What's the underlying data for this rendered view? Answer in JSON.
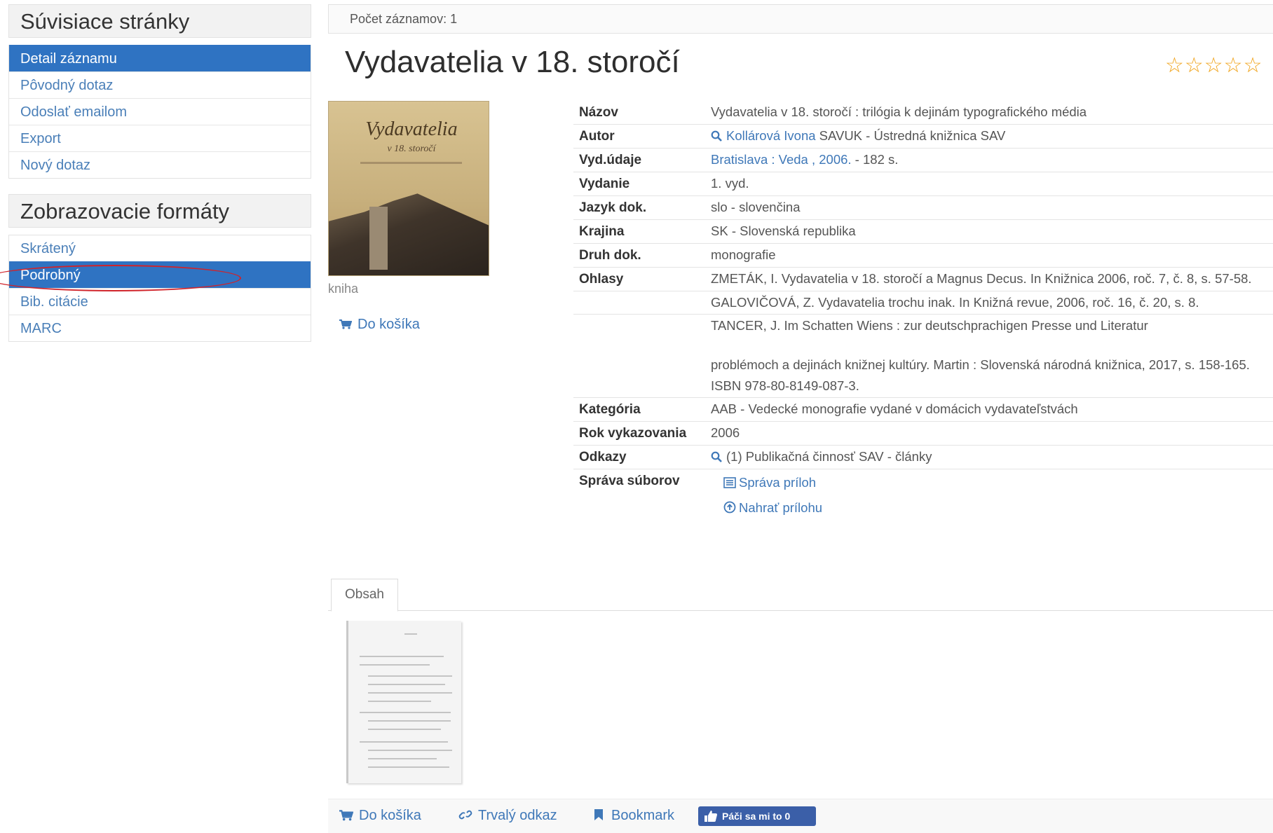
{
  "sidebar": {
    "related_title": "Súvisiace stránky",
    "related_items": [
      "Detail záznamu",
      "Pôvodný dotaz",
      "Odoslať emailom",
      "Export",
      "Nový dotaz"
    ],
    "formats_title": "Zobrazovacie formáty",
    "format_items": [
      "Skrátený",
      "Podrobný",
      "Bib. citácie",
      "MARC"
    ]
  },
  "main": {
    "record_count": "Počet záznamov: 1",
    "title": "Vydavatelia v 18. storočí",
    "rating_stars": "☆☆☆☆☆",
    "doc_type": "kniha",
    "cart_label": "Do košíka"
  },
  "details": {
    "nazov_label": "Názov",
    "nazov": "Vydavatelia v 18. storočí : trilógia k dejinám typografického média",
    "autor_label": "Autor",
    "autor_link": "Kollárová Ivona",
    "autor_rest": "SAVUK - Ústredná knižnica SAV",
    "vyd_udaje_label": "Vyd.údaje",
    "vyd_udaje_link": "Bratislava : Veda , 2006.",
    "vyd_udaje_rest": " - 182 s.",
    "vydanie_label": "Vydanie",
    "vydanie": "1. vyd.",
    "jazyk_label": "Jazyk dok.",
    "jazyk": "slo - slovenčina",
    "krajina_label": "Krajina",
    "krajina": "SK - Slovenská republika",
    "druh_label": "Druh dok.",
    "druh": "monografie",
    "ohlasy_label": "Ohlasy",
    "ohlas_1": "ZMETÁK, I. Vydavatelia v 18. storočí a Magnus Decus. In Knižnica 2006, roč. 7, č. 8, s. 57-58.",
    "ohlas_2": "GALOVIČOVÁ, Z. Vydavatelia trochu inak. In Knižná revue, 2006, roč. 16, č. 20, s. 8.",
    "ohlas_3a": "TANCER, J. Im Schatten Wiens : zur deutschprachigen Presse und Literatur",
    "ohlas_3b": "problémoch a dejinách knižnej kultúry. Martin : Slovenská národná knižnica, 2017, s. 158-165. ISBN 978-80-8149-087-3.",
    "kategoria_label": "Kategória",
    "kategoria": "AAB - Vedecké monografie vydané v domácich vydavateľstvách",
    "rok_label": "Rok vykazovania",
    "rok": "2006",
    "odkazy_label": "Odkazy",
    "odkazy": "(1) Publikačná činnosť SAV - články",
    "sprava_label": "Správa súborov",
    "sprava_priloh": "Správa príloh",
    "nahrat_prilohu": "Nahrať prílohu"
  },
  "tabs": {
    "obsah": "Obsah"
  },
  "footer": {
    "cart": "Do košíka",
    "permalink": "Trvalý odkaz",
    "bookmark": "Bookmark",
    "like": "Páči sa mi to 0"
  },
  "cover": {
    "title": "Vydavatelia",
    "subtitle": "v 18. storočí"
  },
  "colors": {
    "accent": "#2f73c2",
    "link": "#3f78b8",
    "stars": "#f0a31a",
    "highlight": "#d0232a"
  }
}
